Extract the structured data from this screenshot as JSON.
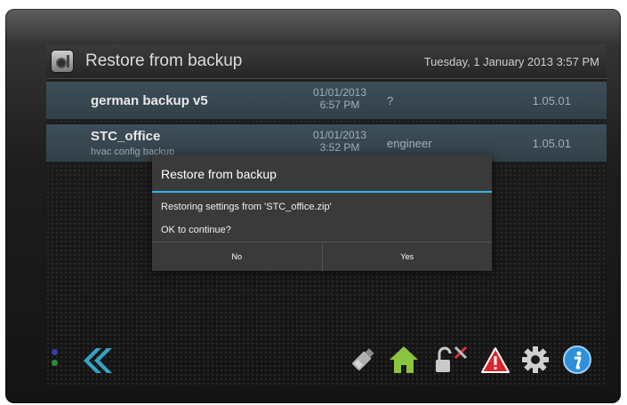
{
  "window": {
    "title": "Restore from backup",
    "datetime": "Tuesday, 1 January 2013 3:57 PM"
  },
  "backups": [
    {
      "name": "german backup v5",
      "subtitle": "",
      "date": "01/01/2013",
      "time": "6:57 PM",
      "user": "?",
      "version": "1.05.01"
    },
    {
      "name": "STC_office",
      "subtitle": "hvac config backup",
      "date": "01/01/2013",
      "time": "3:52 PM",
      "user": "engineer",
      "version": "1.05.01"
    }
  ],
  "dialog": {
    "title": "Restore from backup",
    "message": "Restoring settings from 'STC_office.zip'",
    "question": "OK to continue?",
    "no_label": "No",
    "yes_label": "Yes"
  },
  "toolbar": {
    "icons": [
      "back-icon",
      "usb-drive-icon",
      "home-icon",
      "unlock-tools-icon",
      "warning-icon",
      "settings-icon",
      "info-icon"
    ]
  },
  "colors": {
    "accent": "#33b5e5",
    "row": "#3a4a54",
    "home": "#8bc53f",
    "warning": "#d8262c",
    "info": "#2f8fd8",
    "back": "#36a3c4"
  }
}
